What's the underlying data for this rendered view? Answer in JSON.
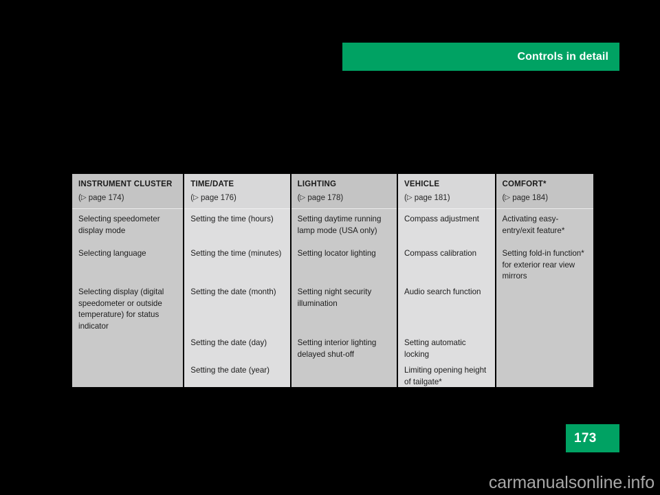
{
  "header": {
    "title": "Controls in detail"
  },
  "page": {
    "number": "173",
    "watermark": "carmanualsonline.info"
  },
  "table": {
    "columns": [
      {
        "title": "INSTRUMENT CLUSTER",
        "page_ref_prefix": "(",
        "page_ref_icon": "▷",
        "page_ref": " page 174)",
        "entries": [
          "Selecting speedometer display mode",
          "Selecting language",
          "Selecting display (digital speedometer or outside temperature) for status indicator"
        ]
      },
      {
        "title": "TIME/DATE",
        "page_ref_prefix": "(",
        "page_ref_icon": "▷",
        "page_ref": " page 176)",
        "entries": [
          "Setting the time (hours)",
          "Setting the time (minutes)",
          "Setting the date (month)",
          "Setting the date (day)",
          "Setting the date (year)"
        ]
      },
      {
        "title": "LIGHTING",
        "page_ref_prefix": "(",
        "page_ref_icon": "▷",
        "page_ref": " page 178)",
        "entries": [
          "Setting daytime running lamp mode (USA only)",
          "Setting locator lighting",
          "Setting night security illumination",
          "Setting interior lighting delayed shut-off"
        ]
      },
      {
        "title": "VEHICLE",
        "page_ref_prefix": "(",
        "page_ref_icon": "▷",
        "page_ref": " page 181)",
        "entries": [
          "Compass adjustment",
          "Compass calibration",
          "Audio search function",
          "Setting automatic locking",
          "Limiting opening height of tailgate*"
        ]
      },
      {
        "title": "COMFORT*",
        "page_ref_prefix": "(",
        "page_ref_icon": "▷",
        "page_ref": " page 184)",
        "entries": [
          "Activating easy-entry/exit feature*",
          "Setting fold-in function* for exterior rear view mirrors"
        ]
      }
    ]
  },
  "colors": {
    "brand_green": "#00a263",
    "column_dark": "#c9c9c9",
    "column_light": "#dededf",
    "page_background": "#000000"
  }
}
